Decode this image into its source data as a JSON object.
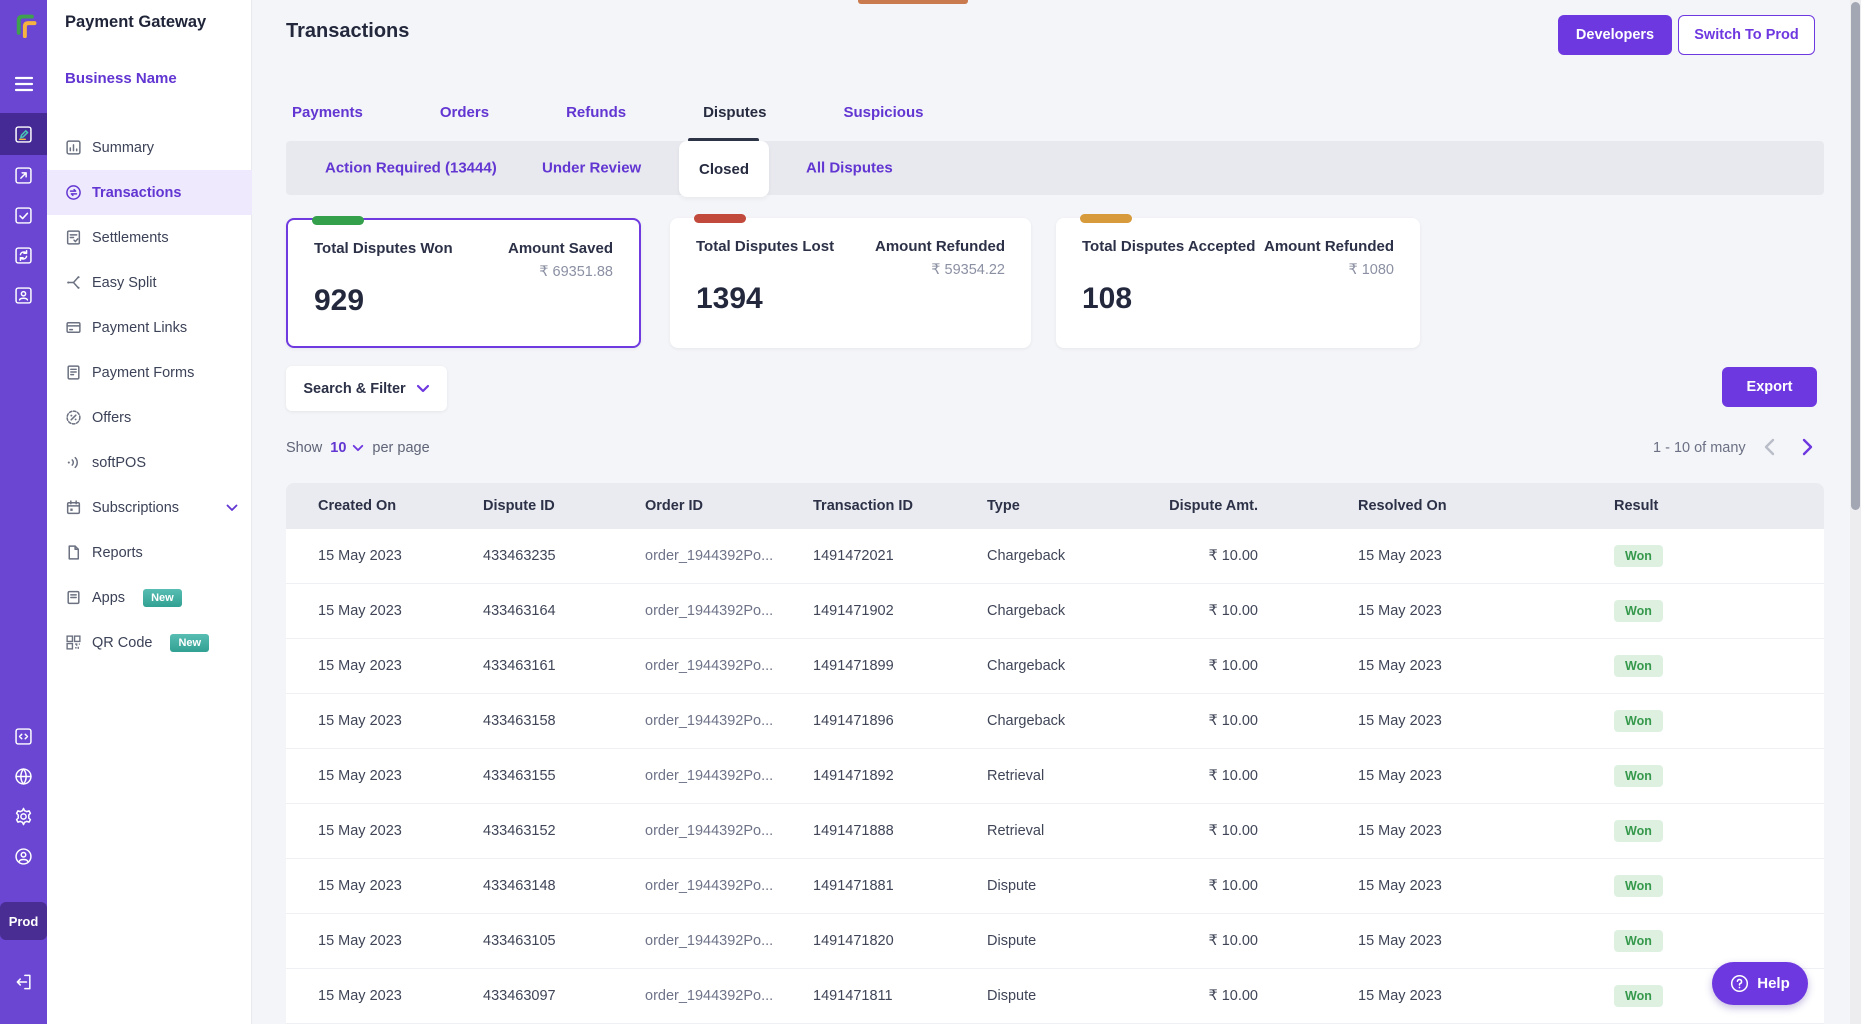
{
  "brand": {
    "product_title": "Payment Gateway",
    "business_name": "Business Name",
    "environment": "Prod"
  },
  "colors": {
    "accent_purple": "#6e38e0",
    "link_purple": "#6236d2",
    "rail_purple": "#6a46d2",
    "green_pill": "#34a04c",
    "red_pill": "#c14a3c",
    "orange_pill": "#d89b3c",
    "won_badge_bg": "#def1e1",
    "won_badge_text": "#35984b",
    "top_notch_orange": "#c97a4e"
  },
  "rail": {
    "icons_top": [
      "hamburger-menu",
      "payments-box",
      "link-out-box",
      "check-doc-box",
      "refresh-box",
      "customer-box"
    ],
    "icons_bottom": [
      "developer-code",
      "globe-time",
      "settings-gear",
      "profile",
      "logout"
    ],
    "environment_label": "Prod"
  },
  "header": {
    "page_title": "Transactions",
    "developers_button": "Developers",
    "switch_to_prod_button": "Switch To Prod"
  },
  "sidebar": {
    "items": [
      {
        "label": "Summary",
        "icon": "bar-chart-icon"
      },
      {
        "label": "Transactions",
        "icon": "transfer-circle-icon",
        "active": true
      },
      {
        "label": "Settlements",
        "icon": "settlement-list-icon"
      },
      {
        "label": "Easy Split",
        "icon": "split-icon"
      },
      {
        "label": "Payment Links",
        "icon": "credit-card-icon"
      },
      {
        "label": "Payment Forms",
        "icon": "form-doc-icon"
      },
      {
        "label": "Offers",
        "icon": "offer-badge-icon"
      },
      {
        "label": "softPOS",
        "icon": "tap-waves-icon"
      },
      {
        "label": "Subscriptions",
        "icon": "calendar-icon",
        "has_chevron": true
      },
      {
        "label": "Reports",
        "icon": "report-file-icon"
      },
      {
        "label": "Apps",
        "icon": "apps-file-icon",
        "badge": "New"
      },
      {
        "label": "QR Code",
        "icon": "qr-code-icon",
        "badge": "New"
      }
    ]
  },
  "tabs": {
    "main": [
      {
        "label": "Payments"
      },
      {
        "label": "Orders"
      },
      {
        "label": "Refunds"
      },
      {
        "label": "Disputes",
        "active": true
      },
      {
        "label": "Suspicious"
      }
    ],
    "sub": [
      {
        "label": "Action Required (13444)"
      },
      {
        "label": "Under Review"
      },
      {
        "label": "Closed",
        "active": true
      },
      {
        "label": "All Disputes"
      }
    ]
  },
  "summary_cards": [
    {
      "pill": "green",
      "title": "Total Disputes Won",
      "amount_label": "Amount Saved",
      "amount_value": "₹ 69351.88",
      "count": "929",
      "selected": true
    },
    {
      "pill": "red",
      "title": "Total Disputes Lost",
      "amount_label": "Amount Refunded",
      "amount_value": "₹ 59354.22",
      "count": "1394"
    },
    {
      "pill": "orange",
      "title": "Total Disputes Accepted",
      "amount_label": "Amount Refunded",
      "amount_value": "₹ 1080",
      "count": "108"
    }
  ],
  "toolbar": {
    "search_filter_label": "Search & Filter",
    "export_label": "Export"
  },
  "list_controls": {
    "show_label": "Show",
    "page_size": "10",
    "per_page_label": "per page",
    "range_label": "1 - 10 of many"
  },
  "table": {
    "columns": [
      "Created On",
      "Dispute ID",
      "Order ID",
      "Transaction ID",
      "Type",
      "Dispute Amt.",
      "Resolved On",
      "Result"
    ],
    "rows": [
      {
        "created": "15 May 2023",
        "dispute_id": "433463235",
        "order_id": "order_1944392Po...",
        "txn_id": "1491472021",
        "type": "Chargeback",
        "amount": "₹ 10.00",
        "resolved": "15 May 2023",
        "result": "Won"
      },
      {
        "created": "15 May 2023",
        "dispute_id": "433463164",
        "order_id": "order_1944392Po...",
        "txn_id": "1491471902",
        "type": "Chargeback",
        "amount": "₹ 10.00",
        "resolved": "15 May 2023",
        "result": "Won"
      },
      {
        "created": "15 May 2023",
        "dispute_id": "433463161",
        "order_id": "order_1944392Po...",
        "txn_id": "1491471899",
        "type": "Chargeback",
        "amount": "₹ 10.00",
        "resolved": "15 May 2023",
        "result": "Won"
      },
      {
        "created": "15 May 2023",
        "dispute_id": "433463158",
        "order_id": "order_1944392Po...",
        "txn_id": "1491471896",
        "type": "Chargeback",
        "amount": "₹ 10.00",
        "resolved": "15 May 2023",
        "result": "Won"
      },
      {
        "created": "15 May 2023",
        "dispute_id": "433463155",
        "order_id": "order_1944392Po...",
        "txn_id": "1491471892",
        "type": "Retrieval",
        "amount": "₹ 10.00",
        "resolved": "15 May 2023",
        "result": "Won"
      },
      {
        "created": "15 May 2023",
        "dispute_id": "433463152",
        "order_id": "order_1944392Po...",
        "txn_id": "1491471888",
        "type": "Retrieval",
        "amount": "₹ 10.00",
        "resolved": "15 May 2023",
        "result": "Won"
      },
      {
        "created": "15 May 2023",
        "dispute_id": "433463148",
        "order_id": "order_1944392Po...",
        "txn_id": "1491471881",
        "type": "Dispute",
        "amount": "₹ 10.00",
        "resolved": "15 May 2023",
        "result": "Won"
      },
      {
        "created": "15 May 2023",
        "dispute_id": "433463105",
        "order_id": "order_1944392Po...",
        "txn_id": "1491471820",
        "type": "Dispute",
        "amount": "₹ 10.00",
        "resolved": "15 May 2023",
        "result": "Won"
      },
      {
        "created": "15 May 2023",
        "dispute_id": "433463097",
        "order_id": "order_1944392Po...",
        "txn_id": "1491471811",
        "type": "Dispute",
        "amount": "₹ 10.00",
        "resolved": "15 May 2023",
        "result": "Won"
      }
    ]
  },
  "help": {
    "label": "Help",
    "icon": "question-circle-icon"
  }
}
